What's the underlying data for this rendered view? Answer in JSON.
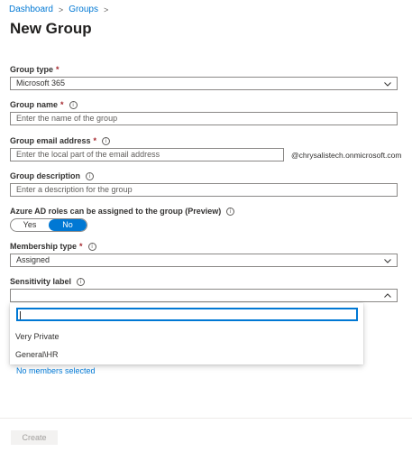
{
  "breadcrumb": {
    "items": [
      "Dashboard",
      "Groups"
    ],
    "separator": ">"
  },
  "page": {
    "title": "New Group"
  },
  "form": {
    "group_type": {
      "label": "Group type",
      "value": "Microsoft 365"
    },
    "group_name": {
      "label": "Group name",
      "placeholder": "Enter the name of the group"
    },
    "group_email": {
      "label": "Group email address",
      "placeholder": "Enter the local part of the email address",
      "suffix": "@chrysalistech.onmicrosoft.com"
    },
    "group_description": {
      "label": "Group description",
      "placeholder": "Enter a description for the group"
    },
    "azure_roles": {
      "label": "Azure AD roles can be assigned to the group (Preview)",
      "options": [
        "Yes",
        "No"
      ],
      "selected": "No"
    },
    "membership_type": {
      "label": "Membership type",
      "value": "Assigned"
    },
    "sensitivity_label": {
      "label": "Sensitivity label",
      "value": ""
    }
  },
  "dropdown": {
    "search_value": "",
    "options": [
      "Very Private",
      "General\\HR"
    ]
  },
  "members": {
    "link_text": "No members selected"
  },
  "footer": {
    "create_label": "Create"
  },
  "colors": {
    "accent": "#0078d4",
    "required": "#a4262c",
    "border": "#8a8886"
  },
  "icons": {
    "info": "info-icon",
    "chevron": "chevron-down-icon",
    "breadcrumb_sep": "chevron-right-icon"
  }
}
